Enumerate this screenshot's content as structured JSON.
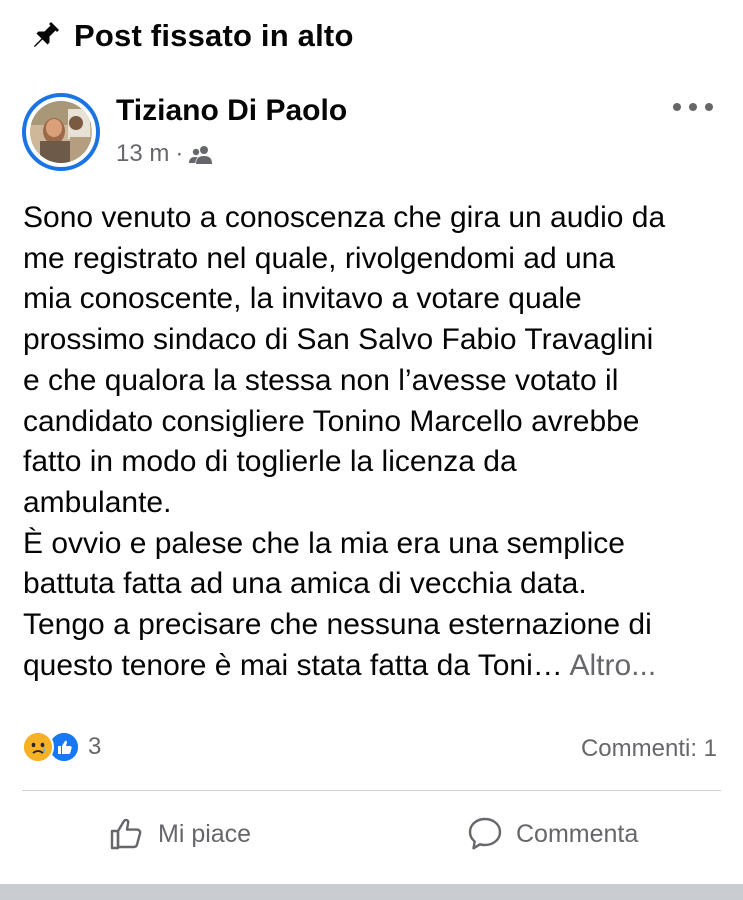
{
  "header": {
    "pin_icon": "pin-icon",
    "title": "Post fissato in alto"
  },
  "post": {
    "author": "Tiziano Di Paolo",
    "time": "13 m",
    "separator": "·",
    "audience_icon": "friends-icon",
    "body_lines": [
      "Sono venuto a conoscenza che gira un audio da",
      "me registrato nel quale, rivolgendomi ad una",
      "mia conoscente, la invitavo a votare quale",
      "prossimo sindaco di San Salvo Fabio Travaglini",
      "e che qualora la stessa non l’avesse votato il",
      "candidato consigliere Tonino Marcello avrebbe",
      "fatto in modo di toglierle la licenza da",
      "ambulante.",
      "È ovvio e palese che la mia era una semplice",
      "battuta fatta ad una amica di vecchia data.",
      "Tengo a precisare che nessuna esternazione di",
      "questo tenore è mai stata fatta da Toni…"
    ],
    "see_more": "Altro...",
    "reactions": {
      "icons": [
        "sad-reaction-icon",
        "like-reaction-icon"
      ],
      "count": "3"
    },
    "comments": "Commenti: 1"
  },
  "actions": {
    "like_label": "Mi piace",
    "comment_label": "Commenta"
  },
  "colors": {
    "accent": "#1b74e4",
    "secondary_text": "#65676b",
    "sad": "#f7b125",
    "like": "#1877f2"
  }
}
